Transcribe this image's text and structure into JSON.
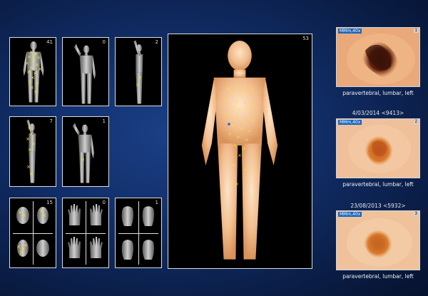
{
  "body_map": {
    "front_count": "41",
    "raised_arm_count": "0",
    "side_count": "2",
    "side_left_count": "7",
    "back_small_count": "1",
    "head_count": "15",
    "hands_count": "0",
    "feet_count": "1",
    "main_back_count": "53"
  },
  "lesions": [
    {
      "magnification": "MMm,40x",
      "index": "1",
      "date": "",
      "location": "paravertebral, lumbar, left"
    },
    {
      "magnification": "MMm,40x",
      "index": "2",
      "date": "4/03/2014 <9413>",
      "location": "paravertebral, lumbar, left"
    },
    {
      "magnification": "MMm,40x",
      "index": "3",
      "date": "23/08/2013 <5932>",
      "location": "paravertebral, lumbar, left"
    }
  ],
  "colors": {
    "marker": "#ffe600",
    "background": "#12306c",
    "panel_border": "#d8dde4",
    "skin_base": "#f3c9a2",
    "lesion_dark": "#4a1a0c"
  }
}
